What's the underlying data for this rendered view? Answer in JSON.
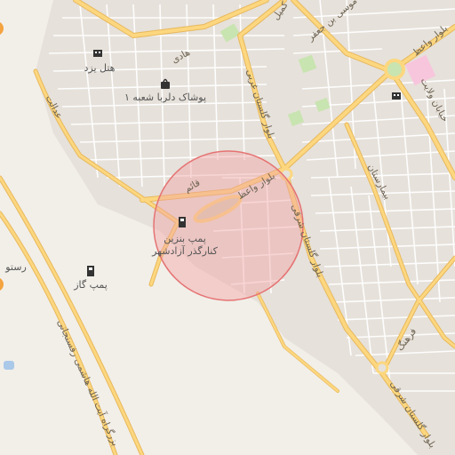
{
  "map": {
    "pois": {
      "hotel_yazd": "هتل یزد",
      "dolba_store": "پوشاک دلربا شعبه ۱",
      "petrol_azadshahr_line1": "پمپ بنزین",
      "petrol_azadshahr_line2": "کنارگذر آزادشهر",
      "pump_gas": "پمپ گاز",
      "restaurant_partial": "رستو"
    },
    "roads": {
      "hadi": "هادی",
      "edalat": "عدالت",
      "kamil": "کمیل",
      "musa_ibn_jafar": "موسی بن جعفر",
      "blvd_vaez_top": "بلوار واعظ",
      "blvd_golestan_gharbi": "بلوار گلستان غربی",
      "blvd_vaez": "بلوار واعظ",
      "ghaem": "قائم",
      "blvd_golestan_sharghi": "بلوار گلستان شرقی",
      "velayat": "خیابان ولایت",
      "bimarestan": "بیمارستان",
      "farhang": "فرهنگ",
      "blvd_golestan_sharghi_2": "بلوار گلستان شرقی",
      "hashemi_rafsanjani": "بزرگراه آیت الله هاشمی رفسنجانی"
    },
    "icons": {
      "hotel": "hotel-icon",
      "shop": "shopping-bag-icon",
      "fuel": "fuel-pump-icon"
    },
    "colors": {
      "background": "#f2efe9",
      "urban": "#e6e1da",
      "road_major": "#fcd77f",
      "road_major_casing": "#e8b85c",
      "park": "#c8e4b0",
      "highlight_fill": "#f1a5a5",
      "highlight_stroke": "#e57373",
      "pink_area": "#f7c6dd"
    }
  }
}
